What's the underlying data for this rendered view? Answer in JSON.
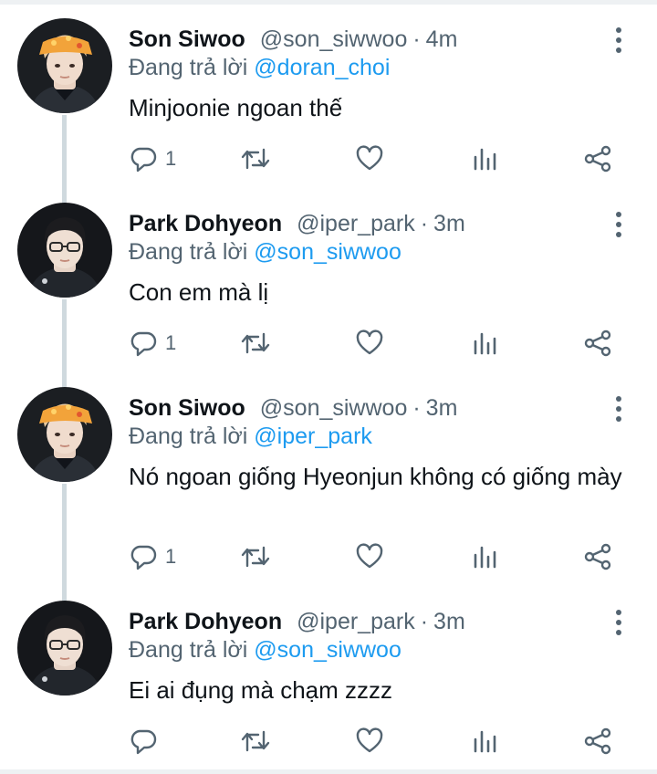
{
  "tweets": [
    {
      "name": "Son Siwoo",
      "handle": "@son_siwwoo",
      "time": "4m",
      "reply_prefix": "Đang trả lời",
      "reply_to": "@doran_choi",
      "text": "Minjoonie ngoan thế",
      "reply_count": "1",
      "avatar": "hat-avatar"
    },
    {
      "name": "Park Dohyeon",
      "handle": "@iper_park",
      "time": "3m",
      "reply_prefix": "Đang trả lời",
      "reply_to": "@son_siwwoo",
      "text": "Con em mà lị",
      "reply_count": "1",
      "avatar": "glasses-avatar"
    },
    {
      "name": "Son Siwoo",
      "handle": "@son_siwwoo",
      "time": "3m",
      "reply_prefix": "Đang trả lời",
      "reply_to": "@iper_park",
      "text": "Nó ngoan giống Hyeonjun không có giống mày",
      "reply_count": "1",
      "avatar": "hat-avatar"
    },
    {
      "name": "Park Dohyeon",
      "handle": "@iper_park",
      "time": "3m",
      "reply_prefix": "Đang trả lời",
      "reply_to": "@son_siwwoo",
      "text": "Ei ai đụng mà chạm zzzz",
      "reply_count": "",
      "avatar": "glasses-avatar"
    }
  ],
  "separator": "·",
  "icons": {
    "reply": "reply-icon",
    "retweet": "retweet-icon",
    "like": "heart-icon",
    "stats": "stats-icon",
    "share": "share-icon",
    "more": "more-icon"
  },
  "colors": {
    "mention": "#1d9bf0",
    "secondary_text": "#536471",
    "thread_line": "#cfd9de"
  }
}
